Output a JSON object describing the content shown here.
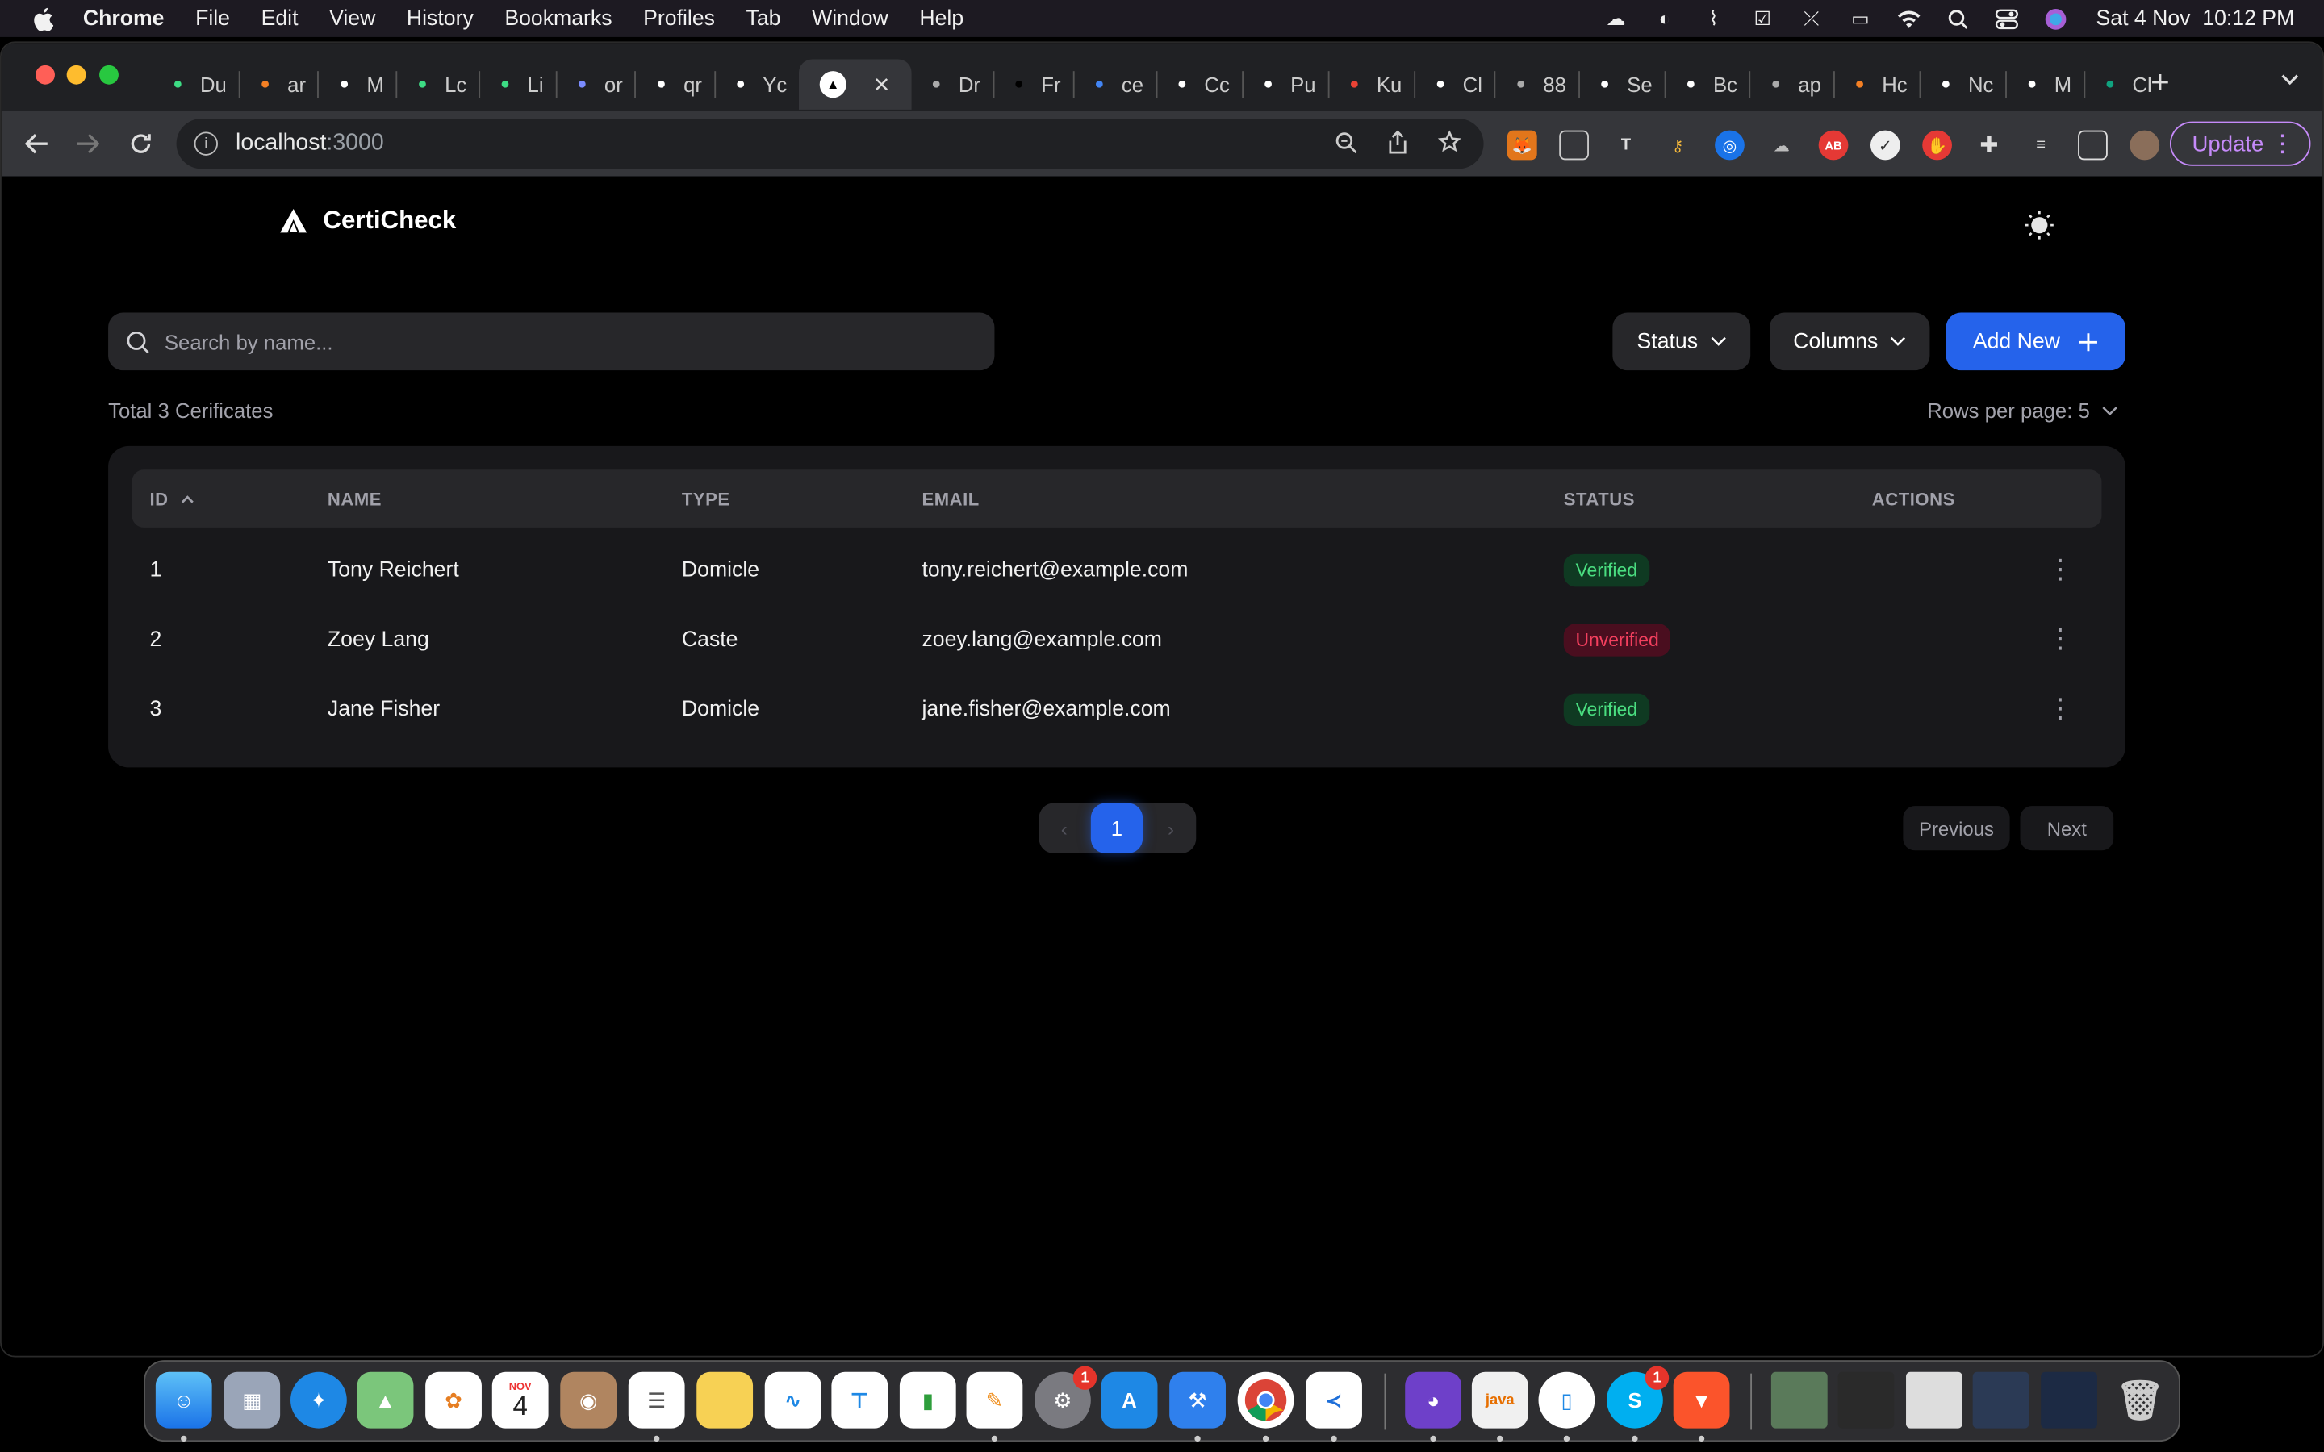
{
  "menubar": {
    "app": "Chrome",
    "items": [
      "File",
      "Edit",
      "View",
      "History",
      "Bookmarks",
      "Profiles",
      "Tab",
      "Window",
      "Help"
    ],
    "datetime": "Sat 4 Nov  10:12 PM"
  },
  "tabs": [
    {
      "label": "Du",
      "icon": "android-icon",
      "color": "#3ddc84"
    },
    {
      "label": "ar",
      "icon": "stackoverflow-icon",
      "color": "#f48024"
    },
    {
      "label": "M",
      "icon": "github-icon",
      "color": "#ffffff"
    },
    {
      "label": "Lc",
      "icon": "android-icon",
      "color": "#3ddc84"
    },
    {
      "label": "Li",
      "icon": "android-icon",
      "color": "#3ddc84"
    },
    {
      "label": "or",
      "icon": "eye-icon",
      "color": "#7b8cff"
    },
    {
      "label": "qr",
      "icon": "vercel-icon",
      "color": "#ffffff"
    },
    {
      "label": "Yc",
      "icon": "github-icon",
      "color": "#ffffff"
    },
    {
      "label": "",
      "icon": "vercel-icon",
      "color": "#ffffff",
      "active": true
    },
    {
      "label": "Dr",
      "icon": "ui-icon",
      "color": "#aaaaaa"
    },
    {
      "label": "Fr",
      "icon": "blank-icon",
      "color": "#000000"
    },
    {
      "label": "ce",
      "icon": "google-icon",
      "color": "#4285f4"
    },
    {
      "label": "Cc",
      "icon": "book-icon",
      "color": "#ffffff"
    },
    {
      "label": "Pu",
      "icon": "book-icon",
      "color": "#ffffff"
    },
    {
      "label": "Ku",
      "icon": "gmail-icon",
      "color": "#ea4335"
    },
    {
      "label": "Cl",
      "icon": "book-icon",
      "color": "#ffffff"
    },
    {
      "label": "88",
      "icon": "globe-icon",
      "color": "#aaaaaa"
    },
    {
      "label": "Se",
      "icon": "gear-icon",
      "color": "#ffffff"
    },
    {
      "label": "Bc",
      "icon": "cb-icon",
      "color": "#ffffff"
    },
    {
      "label": "ap",
      "icon": "globe-icon",
      "color": "#aaaaaa"
    },
    {
      "label": "Hc",
      "icon": "stackoverflow-icon",
      "color": "#f48024"
    },
    {
      "label": "Nc",
      "icon": "chrome-icon",
      "color": "#ffffff"
    },
    {
      "label": "M",
      "icon": "github-icon",
      "color": "#ffffff"
    },
    {
      "label": "Cl",
      "icon": "openai-icon",
      "color": "#10a37f"
    }
  ],
  "toolbar": {
    "url_host": "localhost",
    "url_port": ":3000",
    "update_label": "Update"
  },
  "app": {
    "brand": "CertiCheck",
    "search_placeholder": "Search by name...",
    "status_label": "Status",
    "columns_label": "Columns",
    "add_label": "Add New",
    "total_text": "Total 3 Cerificates",
    "rows_per_page": "Rows per page: 5",
    "columns": [
      "ID",
      "NAME",
      "TYPE",
      "EMAIL",
      "STATUS",
      "ACTIONS"
    ],
    "rows": [
      {
        "id": "1",
        "name": "Tony Reichert",
        "type": "Domicle",
        "email": "tony.reichert@example.com",
        "status": "Verified"
      },
      {
        "id": "2",
        "name": "Zoey Lang",
        "type": "Caste",
        "email": "zoey.lang@example.com",
        "status": "Unverified"
      },
      {
        "id": "3",
        "name": "Jane Fisher",
        "type": "Domicle",
        "email": "jane.fisher@example.com",
        "status": "Verified"
      }
    ],
    "current_page": "1",
    "previous_label": "Previous",
    "next_label": "Next"
  },
  "dock": {
    "calendar_month": "NOV",
    "calendar_day": "4",
    "badges": {
      "settings": "1",
      "skype": "1"
    },
    "apps": [
      "finder-icon",
      "launchpad-icon",
      "safari-icon",
      "maps-icon",
      "photos-icon",
      "calendar-icon",
      "contacts-icon",
      "reminders-icon",
      "notes-icon",
      "freeform-icon",
      "keynote-icon",
      "numbers-icon",
      "pages-icon",
      "system-settings-icon",
      "app-store-icon",
      "xcode-icon",
      "chrome-icon",
      "vscode-icon",
      "github-desktop-icon",
      "java-icon",
      "simulator-icon",
      "skype-icon",
      "brave-icon"
    ]
  },
  "colors": {
    "accent": "#2563eb",
    "verified": "#4ade80",
    "unverified": "#f43f5e"
  }
}
